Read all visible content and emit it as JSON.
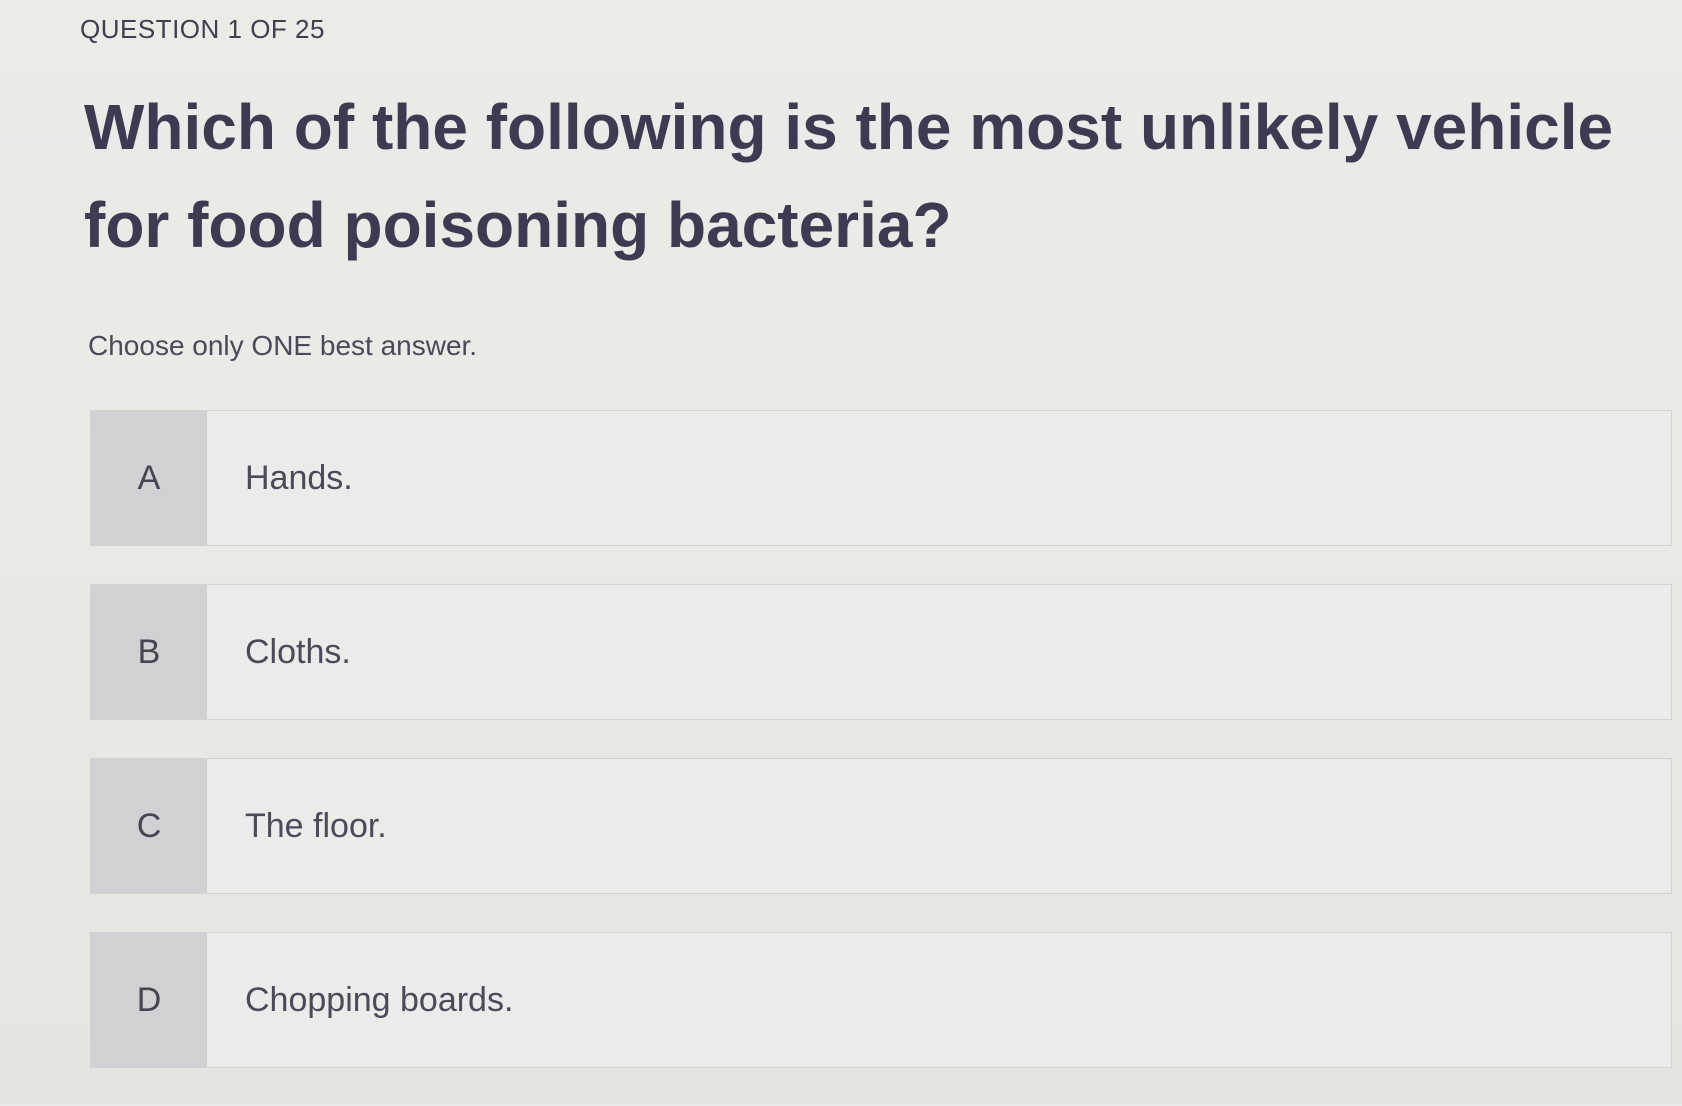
{
  "header": {
    "counter": "QUESTION 1 OF 25"
  },
  "question": {
    "text": "Which of the following is the most unlikely vehicle for food poisoning bacteria?",
    "instruction": "Choose only ONE best answer."
  },
  "options": [
    {
      "letter": "A",
      "text": "Hands."
    },
    {
      "letter": "B",
      "text": "Cloths."
    },
    {
      "letter": "C",
      "text": "The floor."
    },
    {
      "letter": "D",
      "text": "Chopping boards."
    }
  ]
}
